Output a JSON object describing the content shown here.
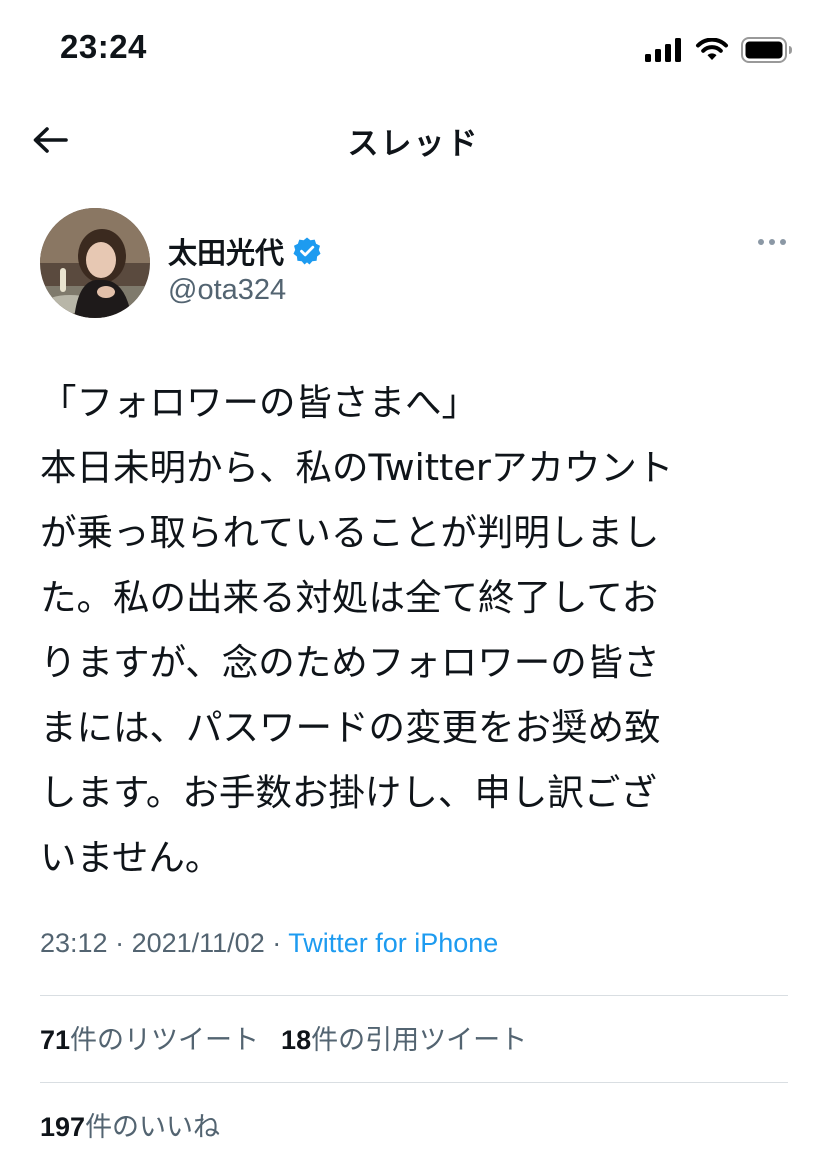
{
  "status_bar": {
    "time": "23:24",
    "icons": [
      "cellular-signal-icon",
      "wifi-icon",
      "battery-icon"
    ]
  },
  "nav": {
    "title": "スレッド",
    "back_icon": "back-arrow-icon"
  },
  "author": {
    "name": "太田光代",
    "verified": true,
    "handle": "@ota324"
  },
  "tweet": {
    "lines": [
      "「フォロワーの皆さまへ」",
      "本日未明から、私のTwitterアカウント",
      "が乗っ取られていることが判明しまし",
      "た。私の出来る対処は全て終了してお",
      "りますが、念のためフォロワーの皆さ",
      "まには、パスワードの変更をお奨め致",
      "します。お手数お掛けし、申し訳ござ",
      "いません。"
    ],
    "time": "23:12",
    "date": "2021/11/02",
    "separator": " · ",
    "source": "Twitter for iPhone"
  },
  "stats": {
    "retweets": {
      "count": "71",
      "label": "件のリツイート"
    },
    "quotes": {
      "count": "18",
      "label": "件の引用ツイート"
    },
    "likes": {
      "count": "197",
      "label": "件のいいね"
    }
  },
  "colors": {
    "text": "#0f1419",
    "secondary": "#536471",
    "link": "#1d9bf0",
    "verified": "#1d9bf0",
    "divider": "#d9dee2"
  }
}
